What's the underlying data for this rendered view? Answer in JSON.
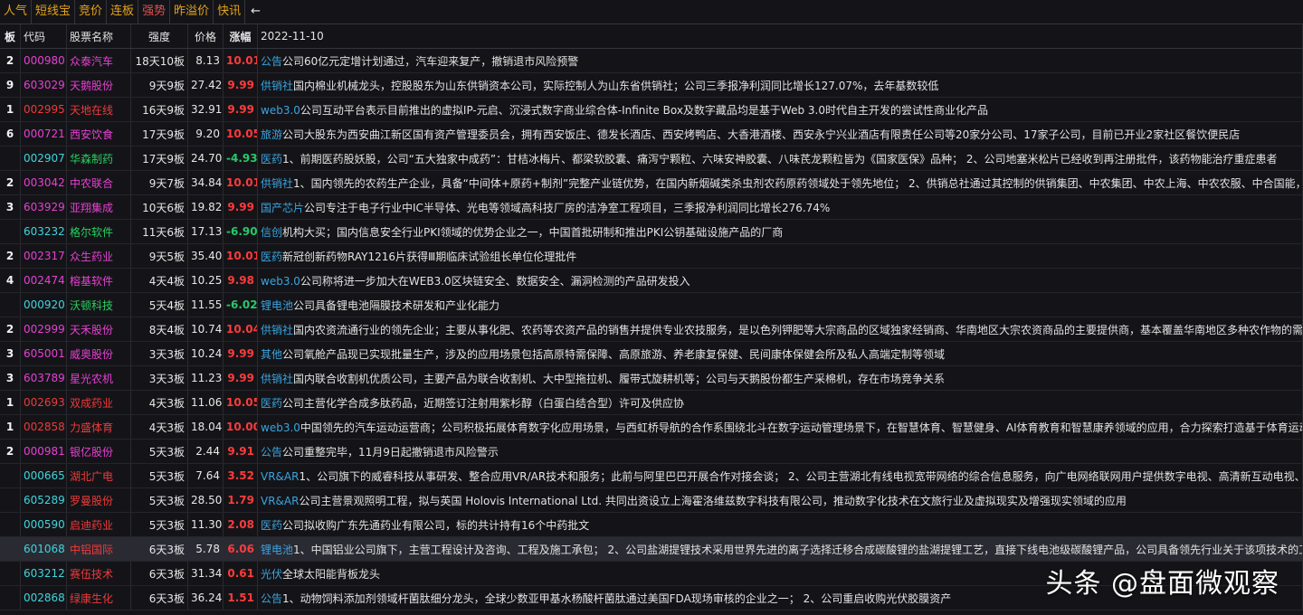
{
  "tabs": [
    {
      "label": "人气",
      "active": false
    },
    {
      "label": "短线宝",
      "active": false
    },
    {
      "label": "竞价",
      "active": false
    },
    {
      "label": "连板",
      "active": false
    },
    {
      "label": "强势",
      "active": true
    },
    {
      "label": "昨溢价",
      "active": false
    },
    {
      "label": "快讯",
      "active": false
    }
  ],
  "back_arrow": "←",
  "header": {
    "board": "板",
    "code": "代码",
    "name": "股票名称",
    "strength": "强度",
    "price": "价格",
    "change": "涨幅",
    "date": "2022-11-10"
  },
  "colors": {
    "up": "#ff3b3b",
    "down": "#27c96b",
    "tag": "#3aa4e0",
    "magenta": "#e640d2",
    "cyan": "#3fd5dc",
    "tab_text": "#e3a21a",
    "tab_active": "#e05050"
  },
  "rows": [
    {
      "board": "2",
      "code": "000980",
      "name": "众泰汽车",
      "code_color": "magenta",
      "name_color": "magenta",
      "strength": "18天10板",
      "price": "8.13",
      "change": "10.01",
      "dir": "up",
      "tag": "公告",
      "desc": "公司60亿元定增计划通过，汽车迎来复产，撤销退市风险预警"
    },
    {
      "board": "9",
      "code": "603029",
      "name": "天鹅股份",
      "code_color": "magenta",
      "name_color": "magenta",
      "strength": "9天9板",
      "price": "27.42",
      "change": "9.99",
      "dir": "up",
      "tag": "供销社",
      "desc": "国内棉业机械龙头，控股股东为山东供销资本公司，实际控制人为山东省供销社；公司三季报净利润同比增长127.07%，去年基数较低"
    },
    {
      "board": "1",
      "code": "002995",
      "name": "天地在线",
      "code_color": "red",
      "name_color": "red",
      "strength": "16天9板",
      "price": "32.91",
      "change": "9.99",
      "dir": "up",
      "tag": "web3.0",
      "desc": "公司互动平台表示目前推出的虚拟IP-元启、沉浸式数字商业综合体-Infinite Box及数字藏品均是基于Web 3.0时代自主开发的尝试性商业化产品"
    },
    {
      "board": "6",
      "code": "000721",
      "name": "西安饮食",
      "code_color": "magenta",
      "name_color": "magenta",
      "strength": "17天9板",
      "price": "9.20",
      "change": "10.05",
      "dir": "up",
      "tag": "旅游",
      "desc": "公司大股东为西安曲江新区国有资产管理委员会，拥有西安饭庄、德发长酒店、西安烤鸭店、大香港酒楼、西安永宁兴业酒店有限责任公司等20家分公司、17家子公司，目前已开业2家社区餐饮便民店"
    },
    {
      "board": "",
      "code": "002907",
      "name": "华森制药",
      "code_color": "cyan",
      "name_color": "green",
      "strength": "17天9板",
      "price": "24.70",
      "change": "-4.93",
      "dir": "down",
      "tag": "医药",
      "desc": "1、前期医药股妖股，公司“五大独家中成药”：甘桔冰梅片、都梁软胶囊、痛泻宁颗粒、六味安神胶囊、八味芪龙颗粒皆为《国家医保》品种； 2、公司地塞米松片已经收到再注册批件，该药物能治疗重症患者"
    },
    {
      "board": "2",
      "code": "003042",
      "name": "中农联合",
      "code_color": "magenta",
      "name_color": "magenta",
      "strength": "9天7板",
      "price": "34.84",
      "change": "10.01",
      "dir": "up",
      "tag": "供销社",
      "desc": "1、国内领先的农药生产企业，具备“中间体+原药+制剂”完整产业链优势，在国内新烟碱类杀虫剂农药原药领域处于领先地位； 2、供销总社通过其控制的供销集团、中农集团、中农上海、中农农服、中合国能，合"
    },
    {
      "board": "3",
      "code": "603929",
      "name": "亚翔集成",
      "code_color": "magenta",
      "name_color": "magenta",
      "strength": "10天6板",
      "price": "19.82",
      "change": "9.99",
      "dir": "up",
      "tag": "国产芯片",
      "desc": "公司专注于电子行业中IC半导体、光电等领域高科技厂房的洁净室工程项目，三季报净利润同比增长276.74%"
    },
    {
      "board": "",
      "code": "603232",
      "name": "格尔软件",
      "code_color": "cyan",
      "name_color": "green",
      "strength": "11天6板",
      "price": "17.13",
      "change": "-6.90",
      "dir": "down",
      "tag": "信创",
      "desc": "机构大买；国内信息安全行业PKI领域的优势企业之一，中国首批研制和推出PKI公钥基础设施产品的厂商"
    },
    {
      "board": "2",
      "code": "002317",
      "name": "众生药业",
      "code_color": "magenta",
      "name_color": "magenta",
      "strength": "9天5板",
      "price": "35.40",
      "change": "10.01",
      "dir": "up",
      "tag": "医药",
      "desc": "新冠创新药物RAY1216片获得Ⅲ期临床试验组长单位伦理批件"
    },
    {
      "board": "4",
      "code": "002474",
      "name": "榕基软件",
      "code_color": "magenta",
      "name_color": "magenta",
      "strength": "4天4板",
      "price": "10.25",
      "change": "9.98",
      "dir": "up",
      "tag": "web3.0",
      "desc": "公司称将进一步加大在WEB3.0区块链安全、数据安全、漏洞检测的产品研发投入"
    },
    {
      "board": "",
      "code": "000920",
      "name": "沃顿科技",
      "code_color": "cyan",
      "name_color": "green",
      "strength": "5天4板",
      "price": "11.55",
      "change": "-6.02",
      "dir": "down",
      "tag": "锂电池",
      "desc": "公司具备锂电池隔膜技术研发和产业化能力"
    },
    {
      "board": "2",
      "code": "002999",
      "name": "天禾股份",
      "code_color": "magenta",
      "name_color": "magenta",
      "strength": "8天4板",
      "price": "10.74",
      "change": "10.04",
      "dir": "up",
      "tag": "供销社",
      "desc": "国内农资流通行业的领先企业；主要从事化肥、农药等农资产品的销售并提供专业农技服务，是以色列钾肥等大宗商品的区域独家经销商、华南地区大宗农资商品的主要提供商，基本覆盖华南地区多种农作物的需求"
    },
    {
      "board": "3",
      "code": "605001",
      "name": "威奥股份",
      "code_color": "magenta",
      "name_color": "magenta",
      "strength": "3天3板",
      "price": "10.24",
      "change": "9.99",
      "dir": "up",
      "tag": "其他",
      "desc": "公司氧舱产品现已实现批量生产，涉及的应用场景包括高原特需保障、高原旅游、养老康复保健、民间康体保健会所及私人高端定制等领域"
    },
    {
      "board": "3",
      "code": "603789",
      "name": "星光农机",
      "code_color": "magenta",
      "name_color": "magenta",
      "strength": "3天3板",
      "price": "11.23",
      "change": "9.99",
      "dir": "up",
      "tag": "供销社",
      "desc": "国内联合收割机优质公司，主要产品为联合收割机、大中型拖拉机、履带式旋耕机等；公司与天鹅股份都生产采棉机，存在市场竞争关系"
    },
    {
      "board": "1",
      "code": "002693",
      "name": "双成药业",
      "code_color": "red",
      "name_color": "red",
      "strength": "4天3板",
      "price": "11.06",
      "change": "10.05",
      "dir": "up",
      "tag": "医药",
      "desc": "公司主营化学合成多肽药品，近期签订注射用紫杉醇（白蛋白结合型）许可及供应协"
    },
    {
      "board": "1",
      "code": "002858",
      "name": "力盛体育",
      "code_color": "red",
      "name_color": "red",
      "strength": "4天3板",
      "price": "18.04",
      "change": "10.00",
      "dir": "up",
      "tag": "web3.0",
      "desc": "中国领先的汽车运动运营商；公司积极拓展体育数字化应用场景，与西虹桥导航的合作系围绕北斗在数字运动管理场景下，在智慧体育、智慧健身、AI体育教育和智慧康养领域的应用，合力探索打造基于体育运动的W"
    },
    {
      "board": "2",
      "code": "000981",
      "name": "银亿股份",
      "code_color": "magenta",
      "name_color": "magenta",
      "strength": "5天3板",
      "price": "2.44",
      "change": "9.91",
      "dir": "up",
      "tag": "公告",
      "desc": "公司重整完毕，11月9日起撤销退市风险警示"
    },
    {
      "board": "",
      "code": "000665",
      "name": "湖北广电",
      "code_color": "cyan",
      "name_color": "red",
      "strength": "5天3板",
      "price": "7.64",
      "change": "3.52",
      "dir": "up",
      "tag": "VR&AR",
      "desc": "1、公司旗下的威睿科技从事研发、整合应用VR/AR技术和服务；此前与阿里巴巴开展合作对接会谈； 2、公司主营湖北有线电视宽带网络的综合信息服务，向广电网络联网用户提供数字电视、高清新互动电视、宽带"
    },
    {
      "board": "",
      "code": "605289",
      "name": "罗曼股份",
      "code_color": "cyan",
      "name_color": "red",
      "strength": "5天3板",
      "price": "28.50",
      "change": "1.79",
      "dir": "up",
      "tag": "VR&AR",
      "desc": "公司主营景观照明工程，拟与英国 Holovis International Ltd. 共同出资设立上海霍洛维兹数字科技有限公司，推动数字化技术在文旅行业及虚拟现实及增强现实领域的应用"
    },
    {
      "board": "",
      "code": "000590",
      "name": "启迪药业",
      "code_color": "cyan",
      "name_color": "red",
      "strength": "5天3板",
      "price": "11.30",
      "change": "2.08",
      "dir": "up",
      "tag": "医药",
      "desc": "公司拟收购广东先通药业有限公司，标的共计持有16个中药批文"
    },
    {
      "board": "",
      "code": "601068",
      "name": "中铝国际",
      "code_color": "cyan",
      "name_color": "red",
      "strength": "6天3板",
      "price": "5.78",
      "change": "6.06",
      "dir": "up",
      "tag": "锂电池",
      "desc": "1、中国铝业公司旗下，主营工程设计及咨询、工程及施工承包； 2、公司盐湖提锂技术采用世界先进的离子选择迁移合成碳酸锂的盐湖提锂工艺，直接下线电池级碳酸锂产品，公司具备领先行业关于该项技术的工程技",
      "selected": true
    },
    {
      "board": "",
      "code": "603212",
      "name": "赛伍技术",
      "code_color": "cyan",
      "name_color": "red",
      "strength": "6天3板",
      "price": "31.34",
      "change": "0.61",
      "dir": "up",
      "tag": "光伏",
      "desc": "全球太阳能背板龙头"
    },
    {
      "board": "",
      "code": "002868",
      "name": "绿康生化",
      "code_color": "cyan",
      "name_color": "red",
      "strength": "6天3板",
      "price": "36.24",
      "change": "1.51",
      "dir": "up",
      "tag": "公告",
      "desc": "1、动物饲料添加剂领域杆菌肽细分龙头，全球少数亚甲基水杨酸杆菌肽通过美国FDA现场审核的企业之一； 2、公司重启收购光伏胶膜资产"
    }
  ],
  "watermark": "头条 @盘面微观察"
}
